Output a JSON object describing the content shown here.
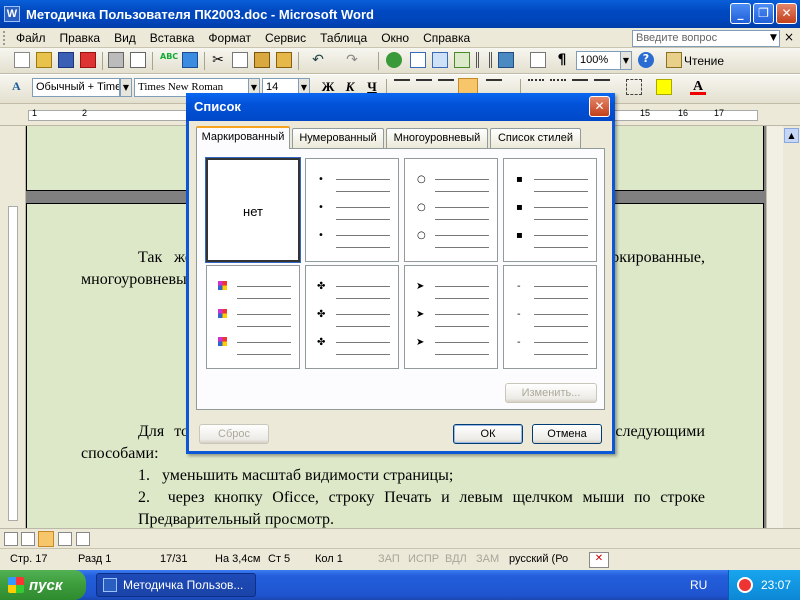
{
  "window": {
    "title": "Методичка Пользователя ПК2003.doc - Microsoft Word",
    "app_icon": "W"
  },
  "menu": {
    "items": [
      "Файл",
      "Правка",
      "Вид",
      "Вставка",
      "Формат",
      "Сервис",
      "Таблица",
      "Окно",
      "Справка"
    ],
    "help_placeholder": "Введите вопрос",
    "close_glyph": "×"
  },
  "toolbar": {
    "zoom": "100%",
    "read_label": "Чтение"
  },
  "format_toolbar": {
    "style": "Обычный + Time",
    "font": "Times New Roman",
    "size": "14",
    "bold": "Ж",
    "italic": "К",
    "underline": "Ч"
  },
  "ruler": {
    "left_labels": [
      "1",
      "2"
    ],
    "right_labels": [
      "15",
      "16",
      "17"
    ]
  },
  "document": {
    "para1": "Так же можно использовать списки, которые могут быть: маркированные, многоуровневые или нумерованные (см. рис.).",
    "para2": "Для того чтобы просмотреть документ, можно воспользоваться следующими способами:",
    "list": [
      {
        "num": "1.",
        "text": "уменьшить масштаб видимости страницы;"
      },
      {
        "num": "2.",
        "text": "через кнопку Oficce, строку Печать и левым щелчком мыши по строке Предварительный просмотр."
      }
    ]
  },
  "dialog": {
    "title": "Список",
    "tabs": [
      "Маркированный",
      "Нумерованный",
      "Многоуровневый",
      "Список стилей"
    ],
    "none_label": "нет",
    "modify_button": "Изменить...",
    "reset_button": "Сброс",
    "ok_button": "ОК",
    "cancel_button": "Отмена",
    "bullet_glyphs": [
      "•",
      "○",
      "▪",
      "✤",
      "➤",
      "-"
    ]
  },
  "status": {
    "page": "Стр. 17",
    "section": "Разд 1",
    "pages": "17/31",
    "at": "На 3,4см",
    "line": "Ст 5",
    "col": "Кол 1",
    "rec": "ЗАП",
    "trk": "ИСПР",
    "ext": "ВДЛ",
    "ovr": "ЗАМ",
    "lang": "русский (Ро"
  },
  "taskbar": {
    "start": "пуск",
    "task": "Методичка Пользов...",
    "lang": "RU",
    "time": "23:07"
  },
  "colors": {
    "title_bar": "#0048c0",
    "chrome": "#ece9d8",
    "page": "#dde8c8",
    "start": "#3c9c3c"
  }
}
